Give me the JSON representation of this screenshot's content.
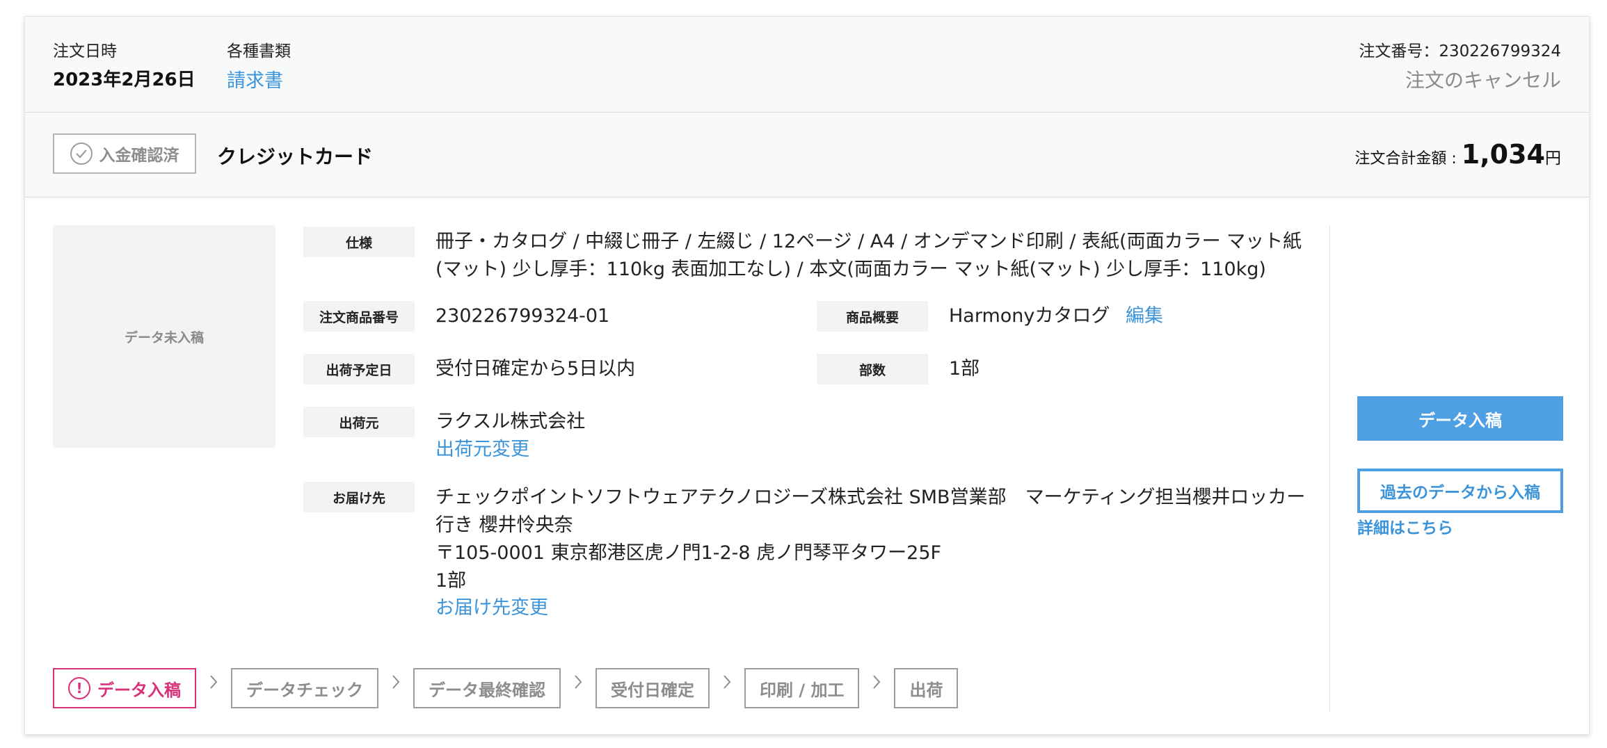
{
  "header": {
    "order_date_label": "注文日時",
    "order_date": "2023年2月26日",
    "documents_label": "各種書類",
    "invoice_link": "請求書",
    "order_number": "注文番号：230226799324",
    "cancel_link": "注文のキャンセル"
  },
  "payment": {
    "status_badge": "入金確認済",
    "method": "クレジットカード",
    "total_label": "注文合計金額 : ",
    "total_amount": "1,034",
    "total_unit": "円"
  },
  "thumbnail": {
    "text": "データ未入稿"
  },
  "details": {
    "spec_label": "仕様",
    "spec_value": "冊子・カタログ / 中綴じ冊子 / 左綴じ / 12ページ / A4 / オンデマンド印刷 / 表紙(両面カラー マット紙(マット) 少し厚手：110kg 表面加工なし) / 本文(両面カラー マット紙(マット) 少し厚手：110kg)",
    "item_number_label": "注文商品番号",
    "item_number": "230226799324-01",
    "summary_label": "商品概要",
    "summary_value": "Harmonyカタログ",
    "edit_link": "編集",
    "ship_date_label": "出荷予定日",
    "ship_date": "受付日確定から5日以内",
    "copies_label": "部数",
    "copies": "1部",
    "shipper_label": "出荷元",
    "shipper": "ラクスル株式会社",
    "shipper_change": "出荷元変更",
    "destination_label": "お届け先",
    "destination_company": "チェックポイントソフトウェアテクノロジーズ株式会社 SMB営業部　マーケティング担当櫻井ロッカー行き 櫻井怜央奈",
    "destination_address": "〒105-0001 東京都港区虎ノ門1-2-8 虎ノ門琴平タワー25F",
    "destination_copies": "1部",
    "destination_change": "お届け先変更"
  },
  "actions": {
    "upload_button": "データ入稿",
    "past_data_button": "過去のデータから入稿",
    "detail_link": "詳細はこちら"
  },
  "steps": [
    {
      "label": "データ入稿",
      "active": true
    },
    {
      "label": "データチェック",
      "active": false
    },
    {
      "label": "データ最終確認",
      "active": false
    },
    {
      "label": "受付日確定",
      "active": false
    },
    {
      "label": "印刷 / 加工",
      "active": false
    },
    {
      "label": "出荷",
      "active": false
    }
  ],
  "colors": {
    "link": "#3b94da",
    "primary_button": "#4e9fe3",
    "active_step": "#d8317a",
    "inactive": "#8d8d8d"
  }
}
